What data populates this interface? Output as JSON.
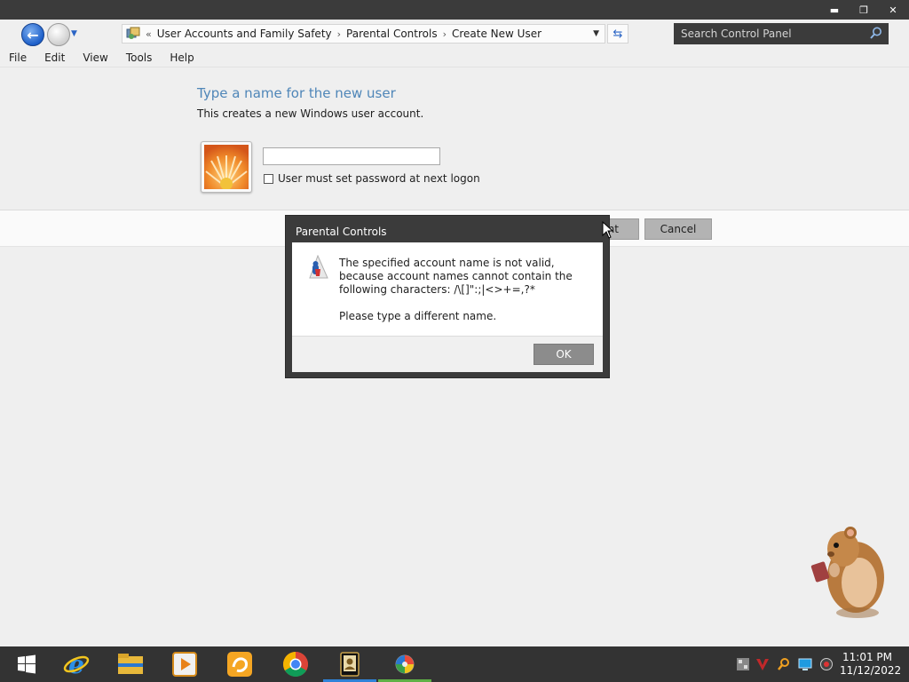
{
  "window": {
    "minimize_glyph": "▬",
    "restore_glyph": "❐",
    "close_glyph": "✕"
  },
  "navigation": {
    "breadcrumb_prefix": "«",
    "breadcrumbs": [
      "User Accounts and Family Safety",
      "Parental Controls",
      "Create New User"
    ],
    "separator": "›",
    "search_placeholder": "Search Control Panel"
  },
  "menu": [
    "File",
    "Edit",
    "View",
    "Tools",
    "Help"
  ],
  "main": {
    "heading": "Type a name for the new user",
    "subtext": "This creates a new Windows user account.",
    "name_value": "",
    "checkbox_label": "User must set password at next logon",
    "checkbox_checked": false,
    "create_button": "Create Account",
    "create_button_visible": "unt",
    "cancel_button": "Cancel"
  },
  "dialog": {
    "title": "Parental Controls",
    "message": "The specified account name is not valid, because account names cannot contain the following characters: /\\[]\":;|<>+=,?*",
    "message2": "Please type a different name.",
    "ok_button": "OK"
  },
  "taskbar": {
    "apps": [
      "start-icon",
      "internet-explorer-icon",
      "file-explorer-icon",
      "media-player-icon",
      "uc-browser-icon",
      "chrome-icon",
      "user-accounts-icon",
      "control-panel-icon"
    ],
    "time": "11:01 PM",
    "date": "11/12/2022"
  },
  "colors": {
    "heading": "#4f86b8",
    "titlebar": "#3b3b3b",
    "taskbar": "#333333",
    "accent": "#2f82d8"
  }
}
